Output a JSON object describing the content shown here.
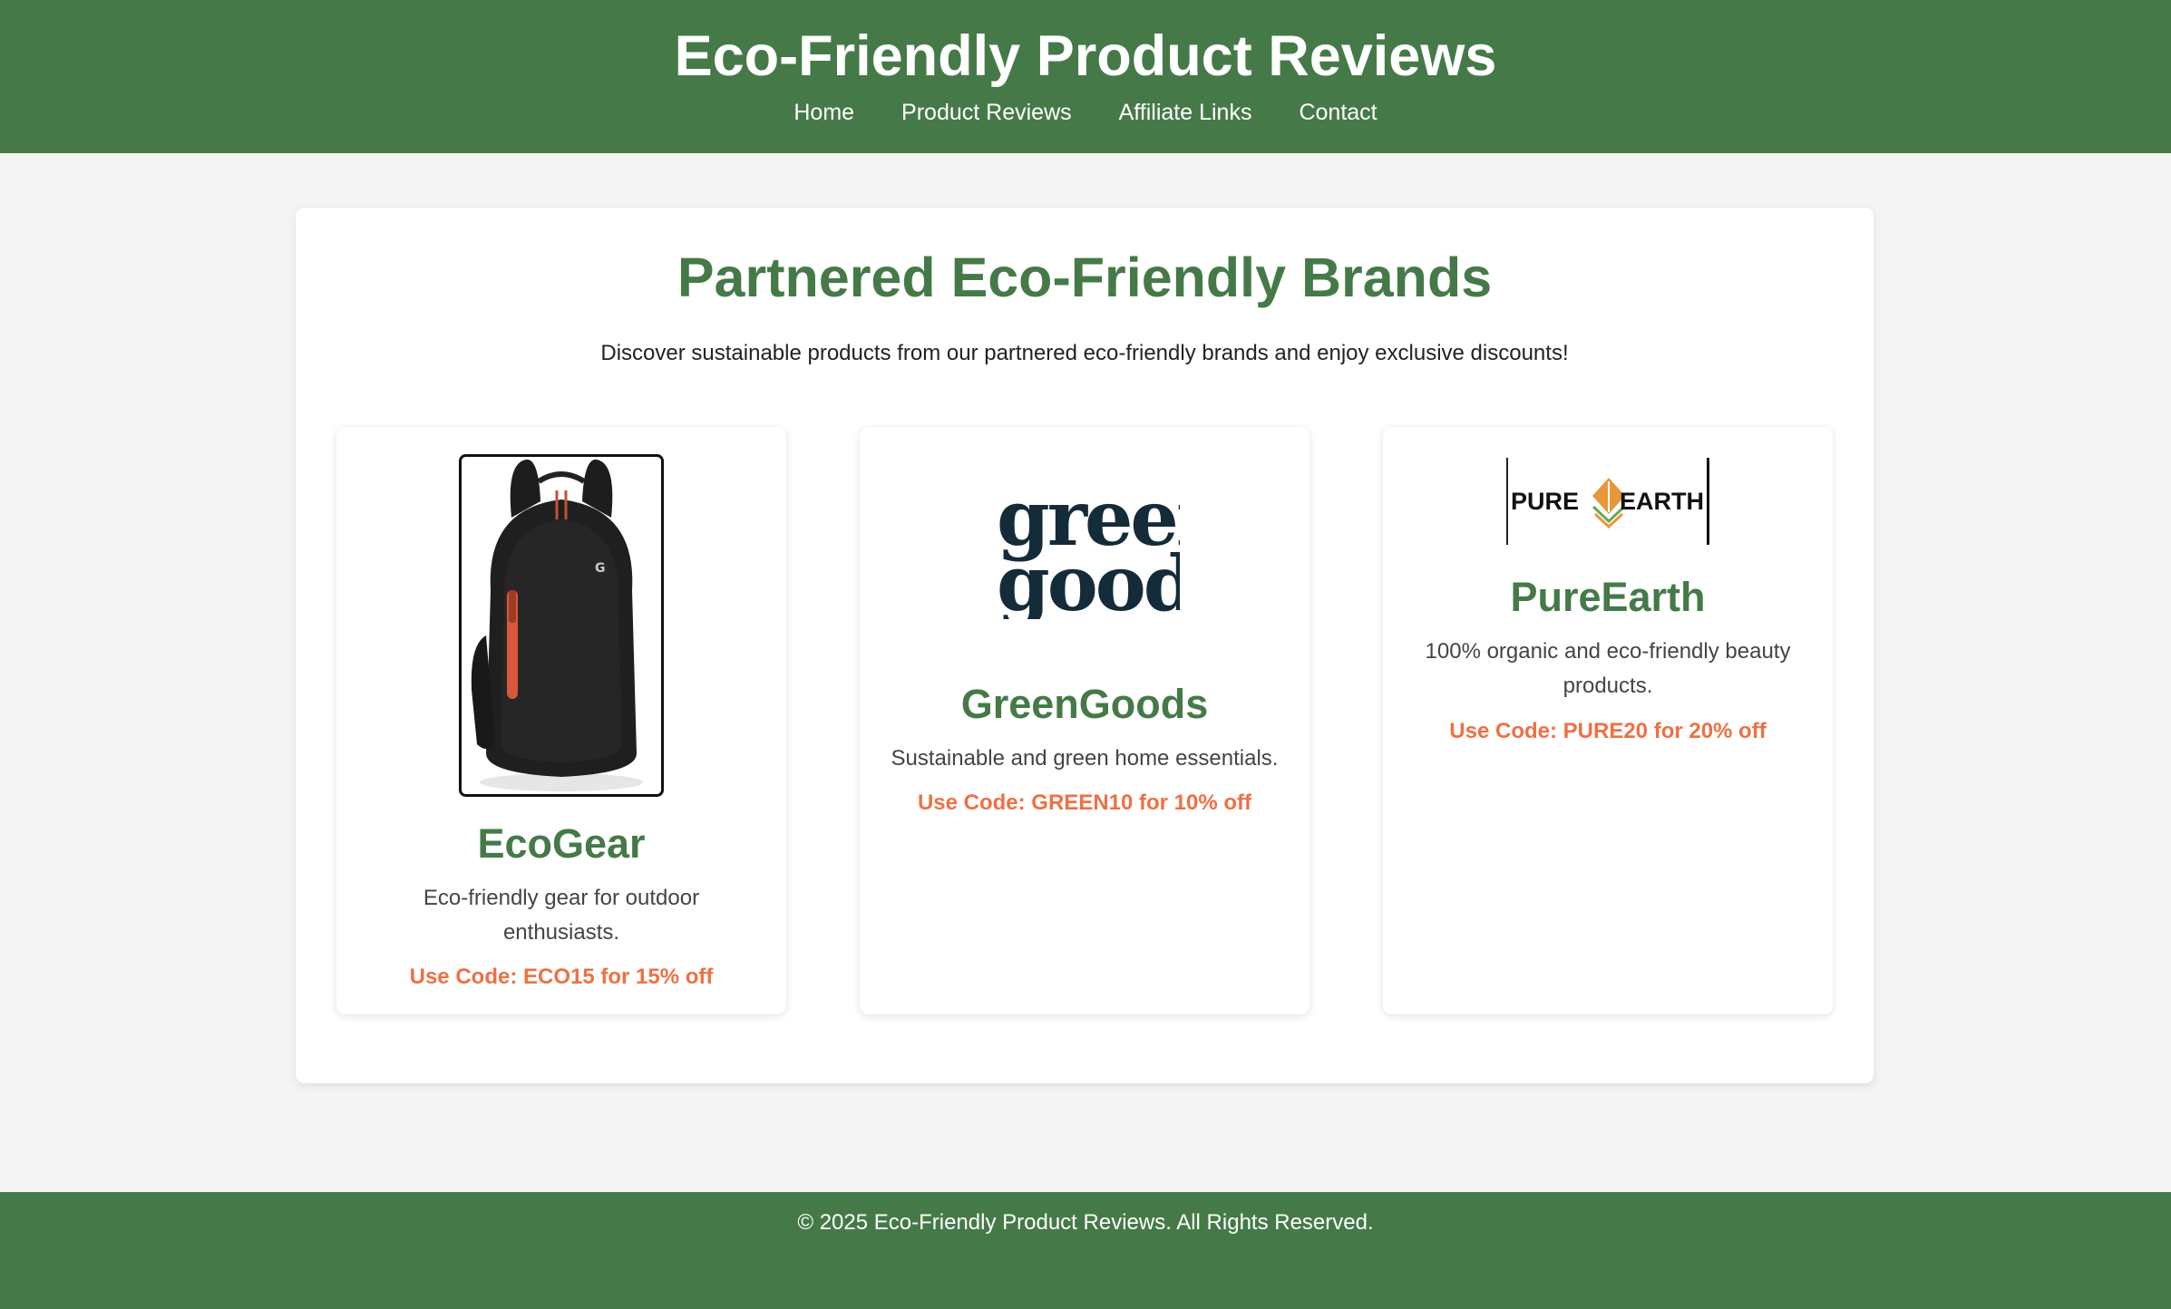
{
  "header": {
    "title": "Eco-Friendly Product Reviews",
    "nav": [
      "Home",
      "Product Reviews",
      "Affiliate Links",
      "Contact"
    ]
  },
  "main": {
    "title": "Partnered Eco-Friendly Brands",
    "intro": "Discover sustainable products from our partnered eco-friendly brands and enjoy exclusive discounts!",
    "brands": [
      {
        "name": "EcoGear",
        "description": "Eco-friendly gear for outdoor enthusiasts.",
        "code": "Use Code: ECO15 for 15% off",
        "image": "backpack-image"
      },
      {
        "name": "GreenGoods",
        "description": "Sustainable and green home essentials.",
        "code": "Use Code: GREEN10 for 10% off",
        "image": "greengoods-logo",
        "logo_text": "green goods"
      },
      {
        "name": "PureEarth",
        "description": "100% organic and eco-friendly beauty products.",
        "code": "Use Code: PURE20 for 20% off",
        "image": "pureearth-logo",
        "logo_text": "PURE EARTH"
      }
    ]
  },
  "footer": {
    "text": "© 2025 Eco-Friendly Product Reviews. All Rights Reserved."
  },
  "colors": {
    "brand_green": "#457a48",
    "accent_orange": "#ef7044",
    "page_background": "#f4f4f4",
    "logo_navy": "#142b3a"
  }
}
